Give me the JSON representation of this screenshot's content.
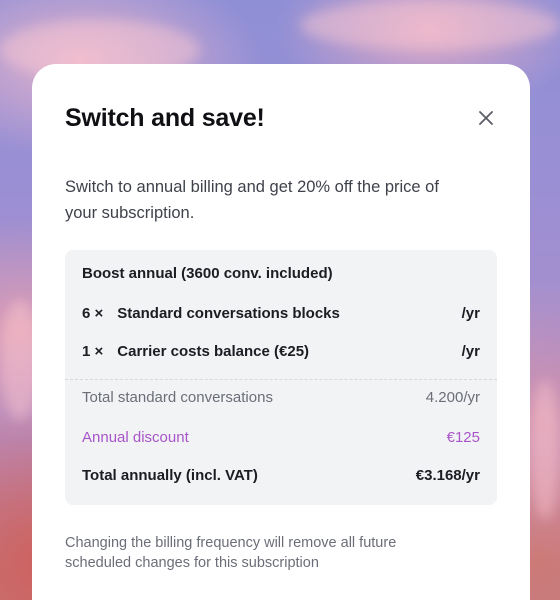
{
  "modal": {
    "title": "Switch and save!",
    "close_icon": "close-icon",
    "description": "Switch to annual billing and get 20% off the price of your subscription."
  },
  "summary": {
    "plan_label": "Boost annual (3600 conv. included)",
    "items": [
      {
        "qty": "6 ×",
        "label": "Standard conversations blocks",
        "price": "/yr"
      },
      {
        "qty": "1 ×",
        "label": "Carrier costs balance (€25)",
        "price": "/yr"
      }
    ],
    "totals": {
      "standard_label": "Total standard conversations",
      "standard_value": "4.200/yr",
      "discount_label": "Annual discount",
      "discount_value": "€125",
      "total_label": "Total annually (incl. VAT)",
      "total_value": "€3.168/yr"
    }
  },
  "footnote": "Changing the billing frequency will remove all future scheduled changes for this subscription",
  "colors": {
    "discount": "#a855c9",
    "card_background": "#ffffff",
    "summary_background": "#f2f3f5"
  }
}
